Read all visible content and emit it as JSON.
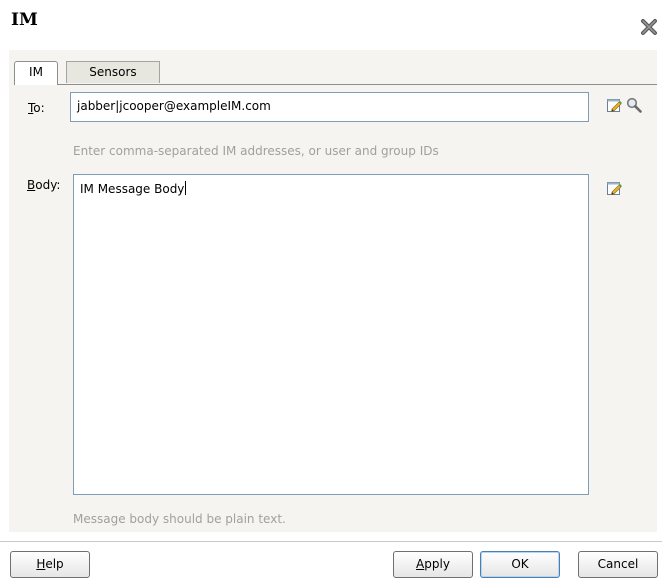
{
  "dialog": {
    "title": "IM"
  },
  "tabs": [
    {
      "label": "IM",
      "active": true
    },
    {
      "label": "Sensors",
      "active": false
    }
  ],
  "to": {
    "label_mnemonic": "T",
    "label_rest": "o:",
    "value": "jabber|jcooper@exampleIM.com",
    "hint": "Enter comma-separated IM addresses, or user and group IDs"
  },
  "body": {
    "label_mnemonic": "B",
    "label_rest": "ody:",
    "value": "IM Message Body",
    "hint": "Message body should be plain text."
  },
  "buttons": {
    "help_mnemonic": "H",
    "help_rest": "elp",
    "apply_mnemonic": "A",
    "apply_rest": "pply",
    "ok": "OK",
    "cancel": "Cancel"
  },
  "icons": {
    "close": "close-icon",
    "edit": "edit-icon",
    "search": "search-icon"
  }
}
